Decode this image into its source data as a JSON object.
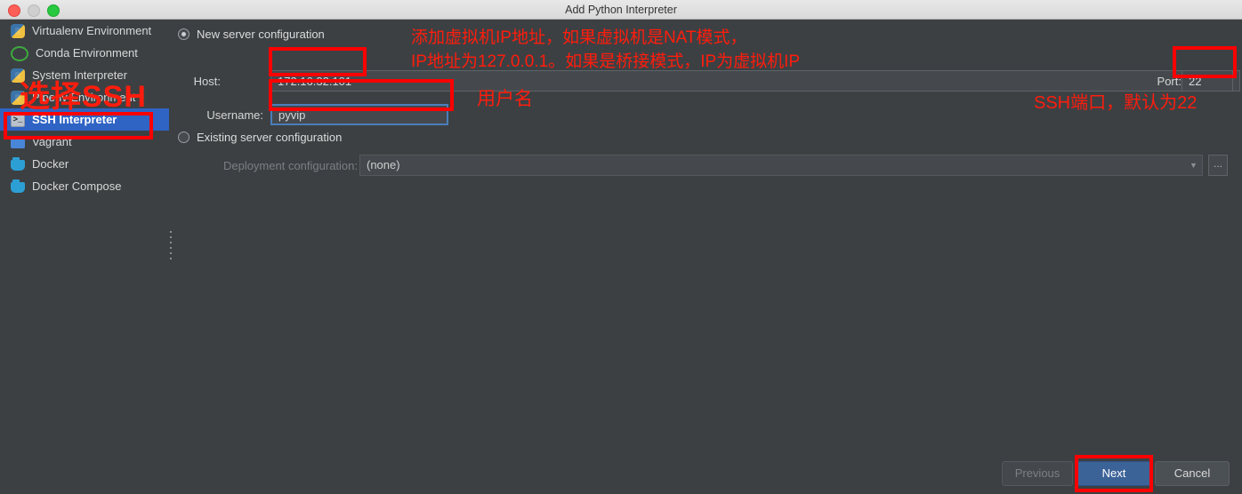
{
  "window": {
    "title": "Add Python Interpreter",
    "traffic_lights": [
      "close",
      "minimize",
      "maximize"
    ]
  },
  "sidebar": {
    "items": [
      {
        "label": "Virtualenv Environment",
        "icon": "python-icon",
        "selected": false
      },
      {
        "label": "Conda Environment",
        "icon": "conda-circle-icon",
        "selected": false
      },
      {
        "label": "System Interpreter",
        "icon": "python-icon",
        "selected": false
      },
      {
        "label": "Pipenv Environment",
        "icon": "python-icon",
        "selected": false
      },
      {
        "label": "SSH Interpreter",
        "icon": "terminal-icon",
        "selected": true
      },
      {
        "label": "Vagrant",
        "icon": "vagrant-square-icon",
        "selected": false
      },
      {
        "label": "Docker",
        "icon": "docker-whale-icon",
        "selected": false
      },
      {
        "label": "Docker Compose",
        "icon": "docker-whale-icon",
        "selected": false
      }
    ]
  },
  "main": {
    "new_server": {
      "radio_label": "New server configuration",
      "selected": true,
      "host_label": "Host:",
      "host_value": "172.16.32.101",
      "port_label": "Port:",
      "port_value": "22",
      "username_label": "Username:",
      "username_value": "pyvip"
    },
    "existing_server": {
      "radio_label": "Existing server configuration",
      "selected": false,
      "deployment_label": "Deployment configuration:",
      "deployment_value": "(none)",
      "browse_label": "...",
      "dropdown_icon": "chevron-down-icon"
    }
  },
  "footer": {
    "previous_label": "Previous",
    "next_label": "Next",
    "cancel_label": "Cancel"
  },
  "annotations": {
    "select_ssh": "选择SSH",
    "ip_note_line1": "添加虚拟机IP地址，如果虚拟机是NAT模式，",
    "ip_note_line2": "IP地址为127.0.0.1。如果是桥接模式，IP为虚拟机IP",
    "username_note": "用户名",
    "port_note": "SSH端口，默认为22",
    "color": "#fe1d0d"
  }
}
